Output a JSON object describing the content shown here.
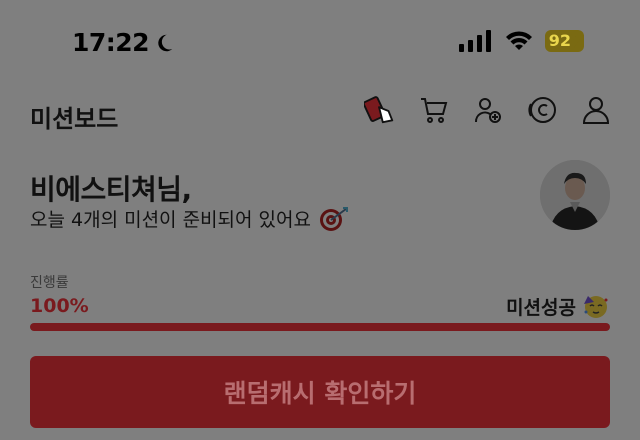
{
  "status_bar": {
    "time": "17:22",
    "moon_icon": "moon-icon",
    "battery": "92",
    "battery_bg": "#7a6a12",
    "battery_fg": "#e9d64d"
  },
  "header": {
    "title": "미션보드",
    "icons": [
      "mission-card-icon",
      "cart-icon",
      "add-user-icon",
      "coin-icon",
      "profile-icon"
    ]
  },
  "greeting": {
    "name": "비에스티쳐님,",
    "subtitle": "오늘 4개의 미션이 준비되어 있어요",
    "target_icon": "dart-target-icon"
  },
  "progress": {
    "label": "진행률",
    "value_text": "100%",
    "fraction": 1.0,
    "status": "미션성공",
    "status_icon": "party-face-icon"
  },
  "cta": {
    "label": "랜덤캐시 확인하기"
  },
  "colors": {
    "accent": "#7a1a1e",
    "overlay_bg": "#7f7f7f"
  }
}
